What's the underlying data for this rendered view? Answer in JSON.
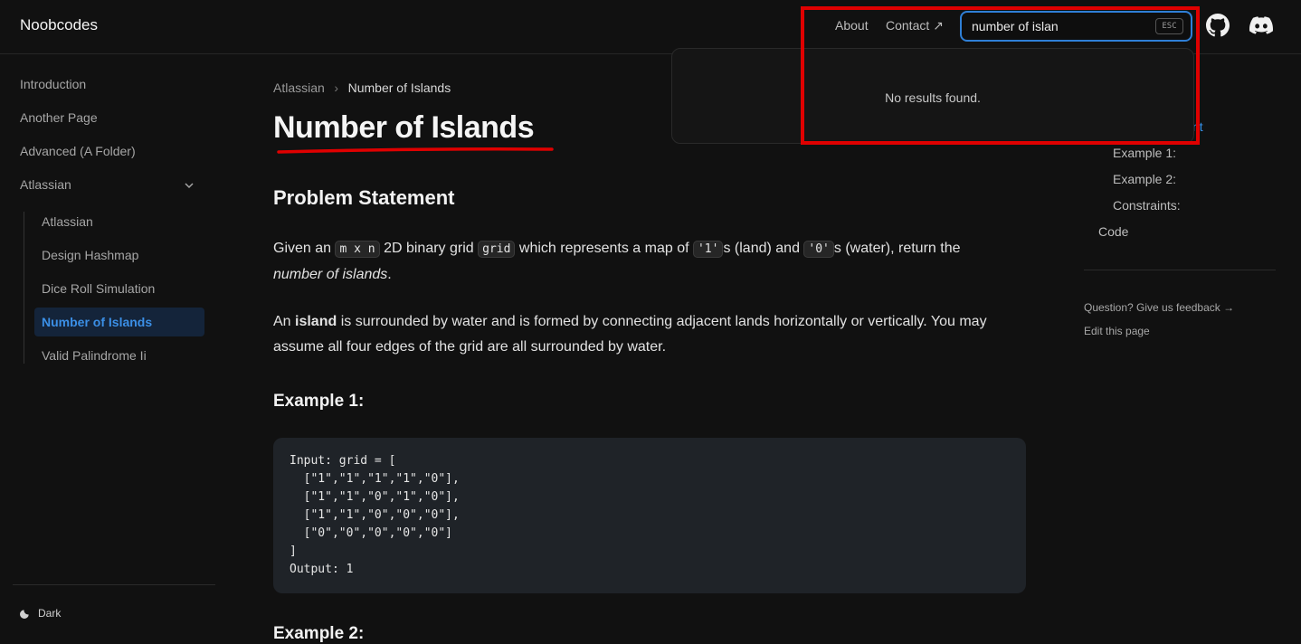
{
  "header": {
    "logo": "Noobcodes",
    "about": "About",
    "contact": "Contact ↗",
    "search_value": "number of islan",
    "esc_label": "ESC",
    "github_icon": "github-icon",
    "discord_icon": "discord-icon"
  },
  "search_dropdown": {
    "message": "No results found."
  },
  "sidebar": {
    "items": [
      {
        "label": "Introduction"
      },
      {
        "label": "Another Page"
      },
      {
        "label": "Advanced (A Folder)"
      },
      {
        "label": "Atlassian"
      }
    ],
    "sub_items": [
      {
        "label": "Atlassian"
      },
      {
        "label": "Design Hashmap"
      },
      {
        "label": "Dice Roll Simulation"
      },
      {
        "label": "Number of Islands"
      },
      {
        "label": "Valid Palindrome Ii"
      }
    ],
    "theme_label": "Dark"
  },
  "breadcrumb": {
    "parent": "Atlassian",
    "current": "Number of Islands"
  },
  "content": {
    "title": "Number of Islands",
    "problem_heading": "Problem Statement",
    "p1_a": "Given an ",
    "p1_code1": "m x n",
    "p1_b": " 2D binary grid ",
    "p1_code2": "grid",
    "p1_c": " which represents a map of ",
    "p1_code3": "'1'",
    "p1_d": "s (land) and ",
    "p1_code4": "'0'",
    "p1_e": "s (water), return the",
    "p1_f": "number of islands",
    "p1_g": ".",
    "p2_a": "An ",
    "p2_bold": "island",
    "p2_b": " is surrounded by water and is formed by connecting adjacent lands horizontally or vertically. You may",
    "p2_c": "assume all four edges of the grid are all surrounded by water.",
    "example1_heading": "Example 1:",
    "example1_code": "Input: grid = [\n  [\"1\",\"1\",\"1\",\"1\",\"0\"],\n  [\"1\",\"1\",\"0\",\"1\",\"0\"],\n  [\"1\",\"1\",\"0\",\"0\",\"0\"],\n  [\"0\",\"0\",\"0\",\"0\",\"0\"]\n]\nOutput: 1",
    "example2_heading": "Example 2:"
  },
  "toc": {
    "partial_item": "nt",
    "items": [
      "Example 1:",
      "Example 2:",
      "Constraints:"
    ],
    "code": "Code",
    "feedback": "Question? Give us feedback →",
    "edit": "Edit this page"
  },
  "colors": {
    "accent": "#2f7fd6",
    "active_link": "#3b8fe6",
    "annotation": "#e00000"
  }
}
